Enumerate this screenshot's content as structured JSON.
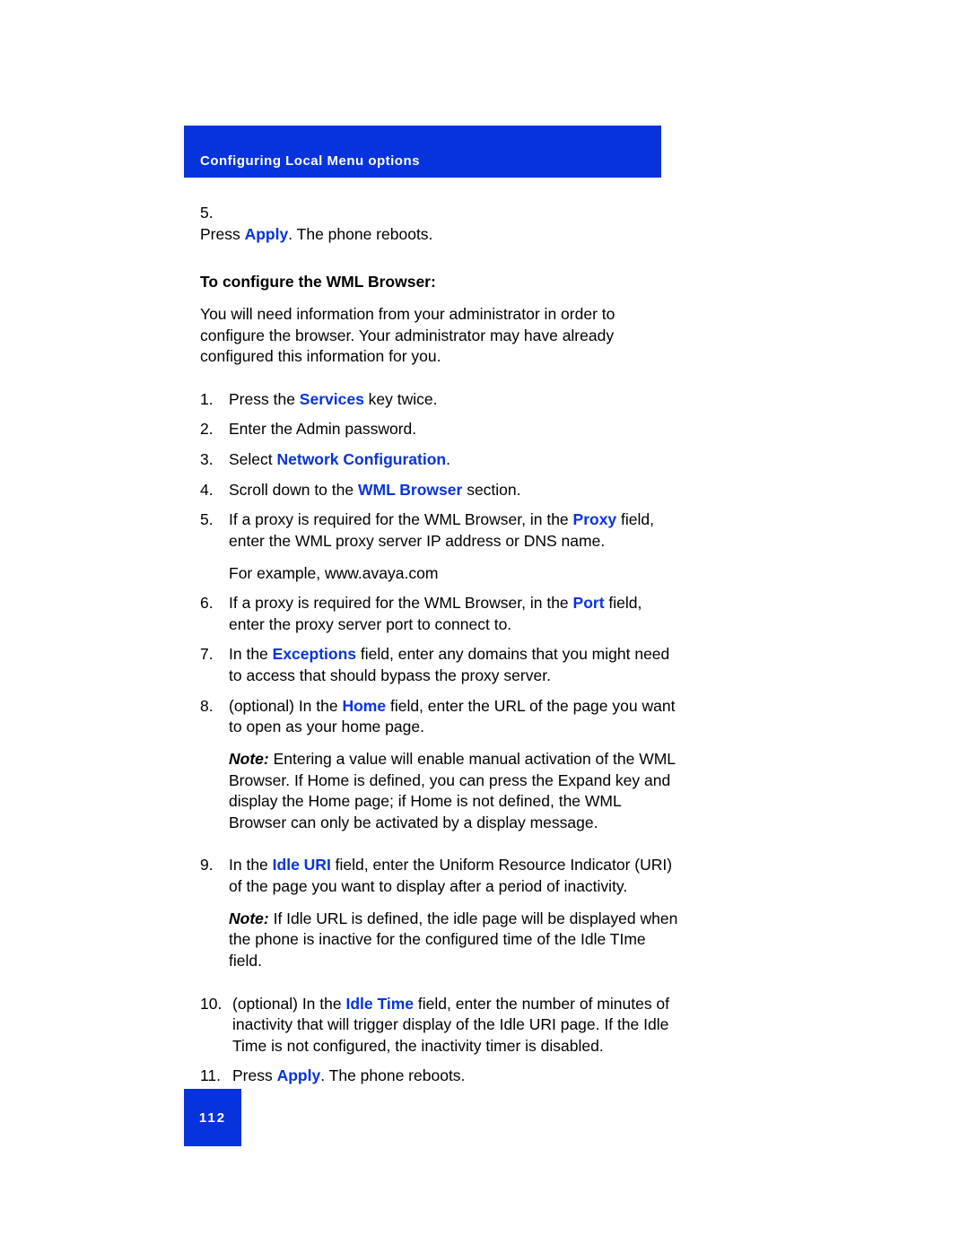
{
  "header": {
    "title": "Configuring Local Menu options"
  },
  "step5": {
    "num": "5.",
    "pre": "Press ",
    "emph": "Apply",
    "post": ". The phone reboots."
  },
  "section": {
    "title": "To configure the WML Browser:",
    "intro": "You will need information from your administrator in order to configure the browser. Your administrator may have already configured this information for you."
  },
  "list": {
    "i1": {
      "num": "1.",
      "pre": "Press the ",
      "emph": "Services",
      "post": " key twice."
    },
    "i2": {
      "num": "2.",
      "text": "Enter the Admin password."
    },
    "i3": {
      "num": "3.",
      "pre": "Select ",
      "emph": "Network Configuration",
      "post": "."
    },
    "i4": {
      "num": "4.",
      "pre": "Scroll down to the ",
      "emph": "WML Browser",
      "post": " section."
    },
    "i5": {
      "num": "5.",
      "pre": "If a proxy is required for the WML Browser, in the ",
      "emph": "Proxy",
      "post": " field, enter the WML proxy server IP address or DNS name.",
      "sub": "For example, www.avaya.com"
    },
    "i6": {
      "num": "6.",
      "pre": "If a proxy is required for the WML Browser, in the ",
      "emph": "Port",
      "post": " field, enter the proxy server port to connect to."
    },
    "i7": {
      "num": "7.",
      "pre": "In the ",
      "emph": "Exceptions",
      "post": " field, enter any domains that you might need to access that should bypass the proxy server."
    },
    "i8": {
      "num": "8.",
      "pre": "(optional) In the ",
      "emph": "Home",
      "post": " field, enter the URL of the page you want to open as your home page.",
      "note_label": "Note:",
      "note_text": " Entering a value will enable manual activation of the WML Browser. If Home is defined, you can press the Expand key and display the Home page; if Home is not defined, the WML Browser can only be activated by a display message."
    },
    "i9": {
      "num": "9.",
      "pre": "In the ",
      "emph": "Idle URI",
      "post": " field, enter the Uniform Resource Indicator (URI) of the page you want to display after a period of inactivity.",
      "note_label": "Note:",
      "note_text": " If Idle URL is defined, the idle page will be displayed when the phone is inactive for the configured time of the Idle TIme field."
    },
    "i10": {
      "num": "10.",
      "pre": "(optional) In the ",
      "emph": "Idle Time",
      "post": " field, enter the number of minutes of inactivity that will trigger display of the Idle URI page. If the Idle Time is not configured, the inactivity timer is disabled."
    },
    "i11": {
      "num": "11.",
      "pre": "Press ",
      "emph": "Apply",
      "post": ". The phone reboots."
    }
  },
  "footer": {
    "page_number": "112"
  }
}
